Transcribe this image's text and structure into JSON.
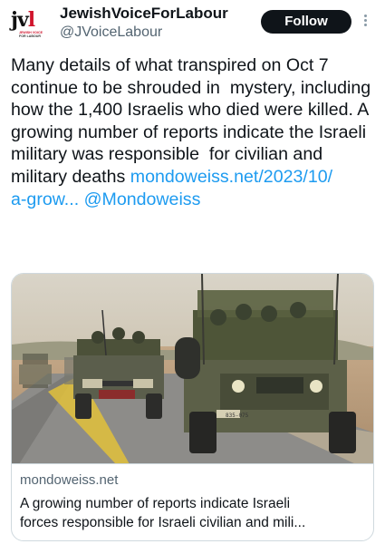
{
  "author": {
    "display_name": "JewishVoiceForLabour",
    "handle": "@JVoiceLabour",
    "avatar_logo": "jvl",
    "avatar_logo_sub_red": "JEWISH VOICE",
    "avatar_logo_sub": "FOR LABOUR"
  },
  "follow_button": {
    "label": "Follow"
  },
  "more_icon": "more-vertical-icon",
  "tweet": {
    "text": "Many details of what transpired on Oct 7 continue to be shrouded in  mystery, including how the 1,400 Israelis who died were killed. A  growing number of reports indicate the Israeli military was responsible  for civilian and military deaths ",
    "link_text": "mondoweiss.net/2023/10/\na-grow...",
    "mention": "@Mondoweiss"
  },
  "card": {
    "image_alt": "military jeeps with soldiers on a desert road",
    "vehicle_plate": "835-075",
    "domain": "mondoweiss.net",
    "title_line_1": "A growing number of reports indicate Israeli",
    "title_line_2": "forces responsible for Israeli civilian and mili..."
  },
  "colors": {
    "text": "#0f1419",
    "secondary": "#536471",
    "link": "#1d9bf0",
    "border": "#cfd9de",
    "button_bg": "#0f1419",
    "brand_red": "#d0142c"
  }
}
